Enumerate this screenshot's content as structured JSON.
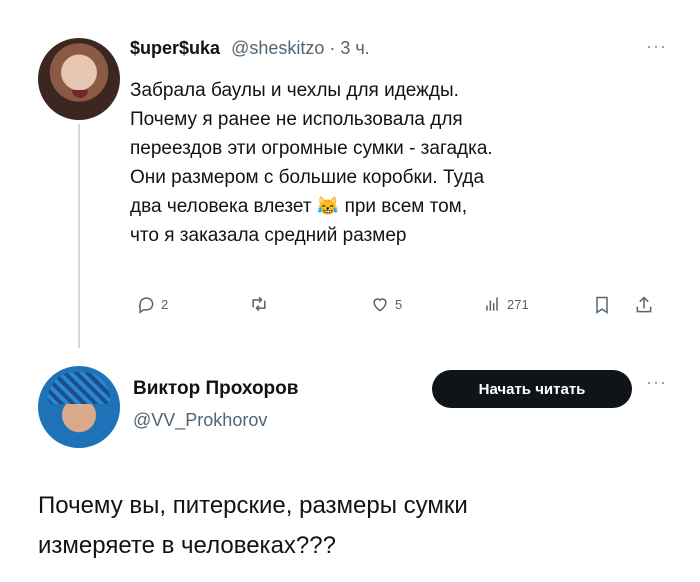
{
  "tweet1": {
    "name": "$uper$uka",
    "handle": "@sheskitzo",
    "time": "3 ч.",
    "more": "···",
    "lines": [
      "Забрала баулы и чехлы для идежды.",
      "Почему я ранее не использовала для",
      "переездов эти огромные сумки - загадка.",
      "Они размером с большие коробки. Туда",
      "два человека влезет",
      "при всем том,",
      "что я заказала средний размер"
    ],
    "emoji": "😹",
    "stats": {
      "replies": "2",
      "likes": "5",
      "views": "271"
    }
  },
  "tweet2": {
    "name": "Виктор Прохоров",
    "handle": "@VV_Prokhorov",
    "follow_label": "Начать читать",
    "more": "···",
    "text_lines": [
      "Почему вы, питерские, размеры сумки",
      "измеряете в человеках???"
    ]
  },
  "icons": {
    "reply": "reply-icon",
    "retweet": "retweet-icon",
    "like": "heart-icon",
    "views": "views-icon",
    "bookmark": "bookmark-icon",
    "share": "share-icon"
  }
}
